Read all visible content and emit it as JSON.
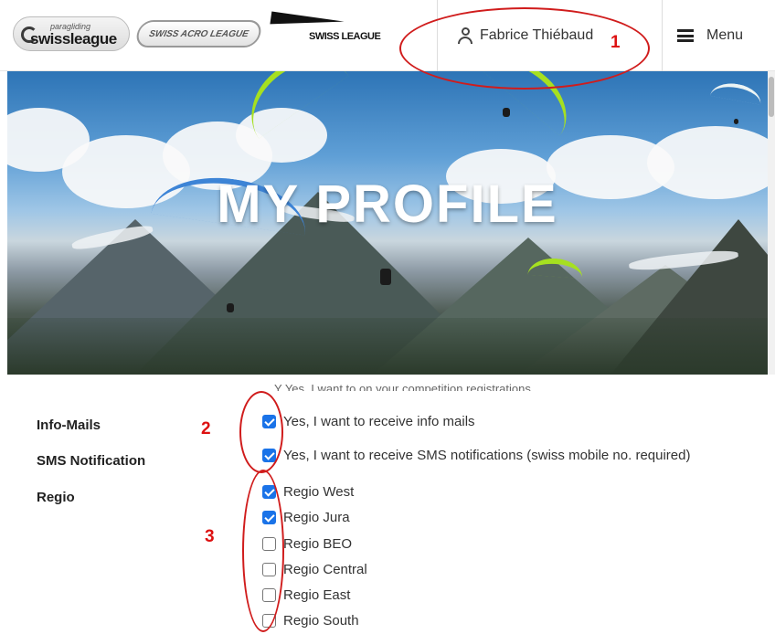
{
  "header": {
    "logo_swissleague_small": "paragliding",
    "logo_swissleague": "swissleague",
    "logo_acro": "SWISS ACRO LEAGUE",
    "logo_hg": "SWISS LEAGUE",
    "user_name": "Fabrice Thiébaud",
    "menu_label": "Menu"
  },
  "hero": {
    "title": "MY PROFILE"
  },
  "form": {
    "cut_text": "Y Yes, I want to on your competition registrations.",
    "info_mails": {
      "label": "Info-Mails",
      "option": "Yes, I want to receive info mails",
      "checked": true
    },
    "sms": {
      "label": "SMS Notification",
      "option": "Yes, I want to receive SMS notifications (swiss mobile no. required)",
      "checked": true
    },
    "regio": {
      "label": "Regio",
      "options": [
        {
          "label": "Regio West",
          "checked": true
        },
        {
          "label": "Regio Jura",
          "checked": true
        },
        {
          "label": "Regio BEO",
          "checked": false
        },
        {
          "label": "Regio Central",
          "checked": false
        },
        {
          "label": "Regio East",
          "checked": false
        },
        {
          "label": "Regio South",
          "checked": false
        }
      ]
    }
  },
  "annotations": {
    "callout_1": "1",
    "callout_2": "2",
    "callout_3": "3",
    "color": "#d01c1c"
  },
  "colors": {
    "checkbox_checked": "#1a73e8"
  }
}
